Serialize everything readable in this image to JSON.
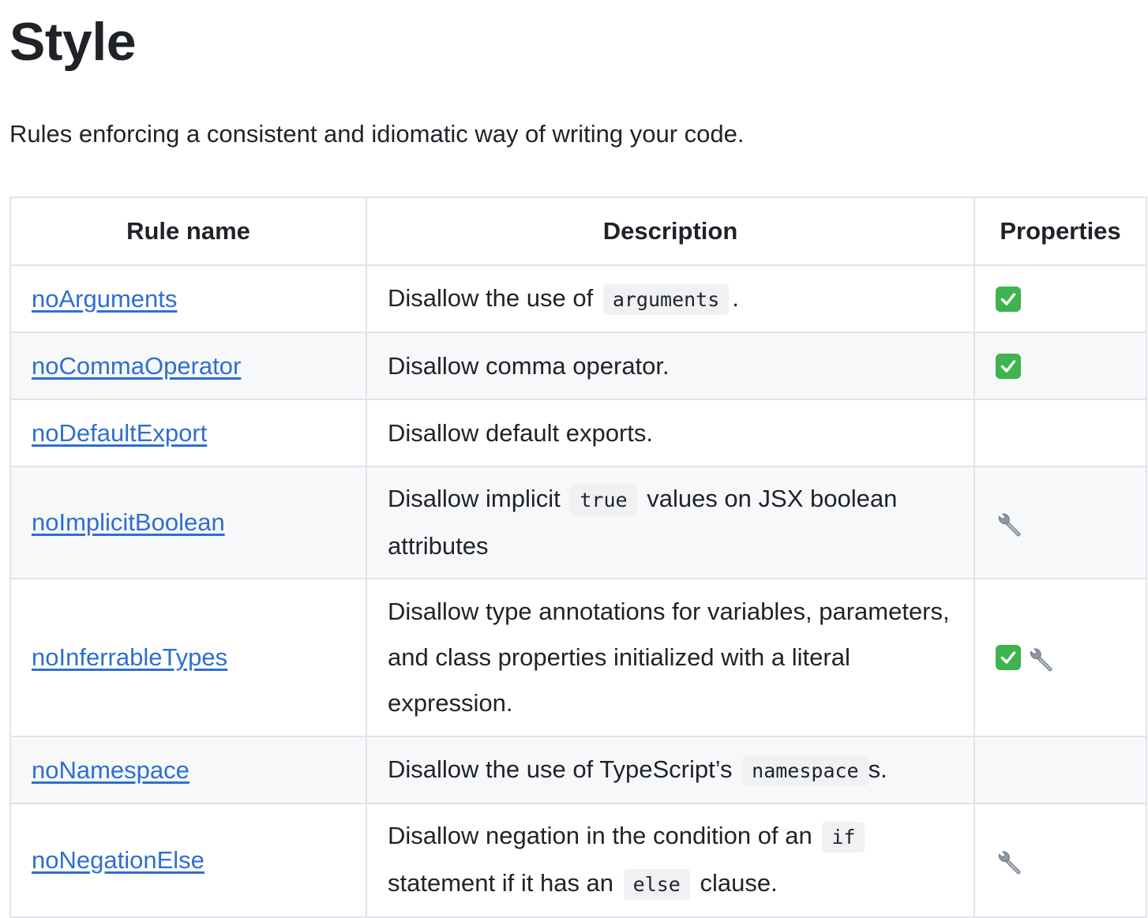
{
  "title": "Style",
  "intro": "Rules enforcing a consistent and idiomatic way of writing your code.",
  "table": {
    "headers": [
      "Rule name",
      "Description",
      "Properties"
    ],
    "rows": [
      {
        "name": "noArguments",
        "desc": [
          "Disallow the use of ",
          "arguments",
          "."
        ],
        "props": [
          "check-icon"
        ]
      },
      {
        "name": "noCommaOperator",
        "desc": [
          "Disallow comma operator."
        ],
        "props": [
          "check-icon"
        ]
      },
      {
        "name": "noDefaultExport",
        "desc": [
          "Disallow default exports."
        ],
        "props": []
      },
      {
        "name": "noImplicitBoolean",
        "desc": [
          "Disallow implicit ",
          "true",
          " values on JSX boolean attributes"
        ],
        "props": [
          "wrench-icon"
        ]
      },
      {
        "name": "noInferrableTypes",
        "desc": [
          "Disallow type annotations for variables, parameters, and class properties initialized with a literal expression."
        ],
        "props": [
          "check-icon",
          "wrench-icon"
        ]
      },
      {
        "name": "noNamespace",
        "desc": [
          "Disallow the use of TypeScript’s ",
          "namespace",
          "s."
        ],
        "props": []
      },
      {
        "name": "noNegationElse",
        "desc": [
          "Disallow negation in the condition of an ",
          "if",
          " statement if it has an ",
          "else",
          " clause."
        ],
        "props": [
          "wrench-icon"
        ]
      }
    ]
  },
  "colors": {
    "link": "#2f6fd0",
    "check": "#3fb34f",
    "stripe": "#f6f8fa",
    "border": "#e1e4e8"
  }
}
